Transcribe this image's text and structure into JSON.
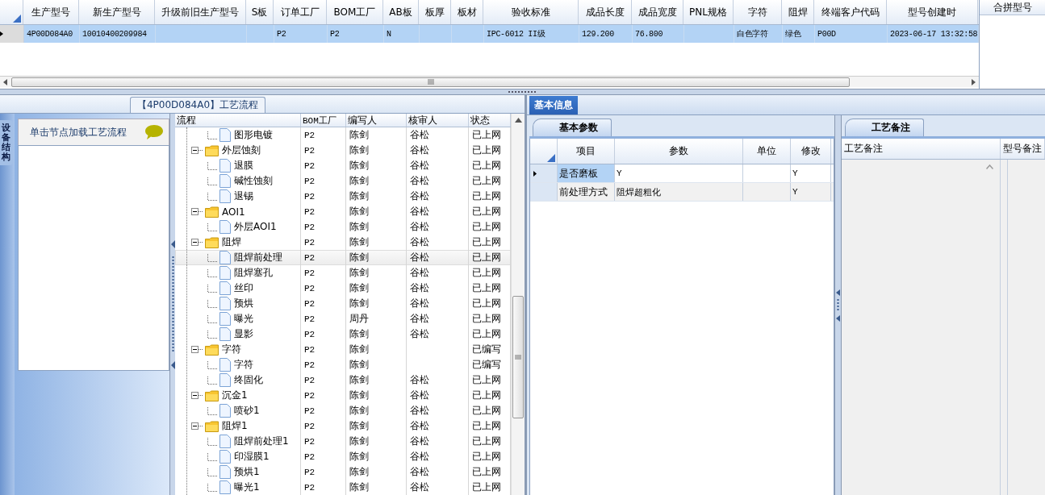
{
  "top_grid": {
    "columns": [
      "生产型号",
      "新生产型号",
      "升级前旧生产型号",
      "S板",
      "订单工厂",
      "BOM工厂",
      "AB板",
      "板厚",
      "板材",
      "验收标准",
      "成品长度",
      "成品宽度",
      "PNL规格",
      "字符",
      "阻焊",
      "终端客户代码",
      "型号创建时"
    ],
    "rows": [
      {
        "selected": true,
        "cells": [
          "4P00D084A0",
          "10010400209984",
          null,
          null,
          "P2",
          "P2",
          "N",
          null,
          null,
          "IPC-6012 II级",
          "129.200",
          "76.800",
          null,
          "白色字符",
          "绿色",
          "P00D",
          "2023-06-17 13:32:58"
        ]
      }
    ]
  },
  "merge_panel": {
    "title": "合拼型号"
  },
  "flow_panel": {
    "title": "【4P00D084A0】工艺流程",
    "side_tab": {
      "label": "设备结构",
      "selected": true
    },
    "hint": "单击节点加载工艺流程",
    "tree": {
      "columns": [
        "流程",
        "BOM工厂",
        "编写人",
        "核审人",
        "状态"
      ],
      "nodes": [
        {
          "children": [
            {
              "kind": "step",
              "label": "图形电镀",
              "bom": "P2",
              "author": "陈剑",
              "reviewer": "谷松",
              "status": "已上网",
              "selected": false
            }
          ]
        },
        {
          "kind": "group",
          "expanded": true,
          "label": "外层蚀刻",
          "bom": "P2",
          "author": "陈剑",
          "reviewer": "谷松",
          "status": "已上网",
          "selected": false,
          "children": [
            {
              "kind": "step",
              "label": "退膜",
              "bom": "P2",
              "author": "陈剑",
              "reviewer": "谷松",
              "status": "已上网",
              "selected": false
            },
            {
              "kind": "step",
              "label": "碱性蚀刻",
              "bom": "P2",
              "author": "陈剑",
              "reviewer": "谷松",
              "status": "已上网",
              "selected": false
            },
            {
              "kind": "step",
              "label": "退锡",
              "bom": "P2",
              "author": "陈剑",
              "reviewer": "谷松",
              "status": "已上网",
              "selected": false
            }
          ]
        },
        {
          "kind": "group",
          "expanded": true,
          "label": "AOI1",
          "bom": "P2",
          "author": "陈剑",
          "reviewer": "谷松",
          "status": "已上网",
          "selected": false,
          "children": [
            {
              "kind": "step",
              "label": "外层AOI1",
              "bom": "P2",
              "author": "陈剑",
              "reviewer": "谷松",
              "status": "已上网",
              "selected": false
            }
          ]
        },
        {
          "kind": "group",
          "expanded": true,
          "label": "阻焊",
          "bom": "P2",
          "author": "陈剑",
          "reviewer": "谷松",
          "status": "已上网",
          "selected": false,
          "children": [
            {
              "kind": "step",
              "label": "阻焊前处理",
              "bom": "P2",
              "author": "陈剑",
              "reviewer": "谷松",
              "status": "已上网",
              "selected": true
            },
            {
              "kind": "step",
              "label": "阻焊塞孔",
              "bom": "P2",
              "author": "陈剑",
              "reviewer": "谷松",
              "status": "已上网",
              "selected": false
            },
            {
              "kind": "step",
              "label": "丝印",
              "bom": "P2",
              "author": "陈剑",
              "reviewer": "谷松",
              "status": "已上网",
              "selected": false
            },
            {
              "kind": "step",
              "label": "预烘",
              "bom": "P2",
              "author": "陈剑",
              "reviewer": "谷松",
              "status": "已上网",
              "selected": false
            },
            {
              "kind": "step",
              "label": "曝光",
              "bom": "P2",
              "author": "周丹",
              "reviewer": "谷松",
              "status": "已上网",
              "selected": false
            },
            {
              "kind": "step",
              "label": "显影",
              "bom": "P2",
              "author": "陈剑",
              "reviewer": "谷松",
              "status": "已上网",
              "selected": false
            }
          ]
        },
        {
          "kind": "group",
          "expanded": true,
          "label": "字符",
          "bom": "P2",
          "author": "陈剑",
          "status": "已编写",
          "selected": false,
          "children": [
            {
              "kind": "step",
              "label": "字符",
              "bom": "P2",
              "author": "陈剑",
              "status": "已编写",
              "selected": false
            },
            {
              "kind": "step",
              "label": "终固化",
              "bom": "P2",
              "author": "陈剑",
              "reviewer": "谷松",
              "status": "已上网",
              "selected": false
            }
          ]
        },
        {
          "kind": "group",
          "expanded": true,
          "label": "沉金1",
          "bom": "P2",
          "author": "陈剑",
          "reviewer": "谷松",
          "status": "已上网",
          "selected": false,
          "children": [
            {
              "kind": "step",
              "label": "喷砂1",
              "bom": "P2",
              "author": "陈剑",
              "reviewer": "谷松",
              "status": "已上网",
              "selected": false
            }
          ]
        },
        {
          "kind": "group",
          "expanded": true,
          "label": "阻焊1",
          "bom": "P2",
          "author": "陈剑",
          "reviewer": "谷松",
          "status": "已上网",
          "selected": false,
          "children": [
            {
              "kind": "step",
              "label": "阻焊前处理1",
              "bom": "P2",
              "author": "陈剑",
              "reviewer": "谷松",
              "status": "已上网",
              "selected": false
            },
            {
              "kind": "step",
              "label": "印湿膜1",
              "bom": "P2",
              "author": "陈剑",
              "reviewer": "谷松",
              "status": "已上网",
              "selected": false
            },
            {
              "kind": "step",
              "label": "预烘1",
              "bom": "P2",
              "author": "陈剑",
              "reviewer": "谷松",
              "status": "已上网",
              "selected": false
            },
            {
              "kind": "step",
              "label": "曝光1",
              "bom": "P2",
              "author": "陈剑",
              "reviewer": "谷松",
              "status": "已上网",
              "selected": false
            }
          ]
        }
      ]
    }
  },
  "info_panel": {
    "tabs": [
      {
        "label": "基本信息",
        "selected": true
      }
    ],
    "params": {
      "tab": {
        "label": "基本参数",
        "selected": true
      },
      "columns": [
        "项目",
        "参数",
        "单位",
        "修改"
      ],
      "rows": [
        {
          "selected": true,
          "cells": [
            "是否磨板",
            "Y",
            null,
            "Y"
          ]
        },
        {
          "selected": false,
          "cells": [
            "前处理方式",
            "阻焊超粗化",
            null,
            "Y"
          ]
        }
      ]
    },
    "notes": {
      "tab": {
        "label": "工艺备注",
        "selected": true
      },
      "columns": [
        "工艺备注",
        "型号备注"
      ]
    }
  }
}
